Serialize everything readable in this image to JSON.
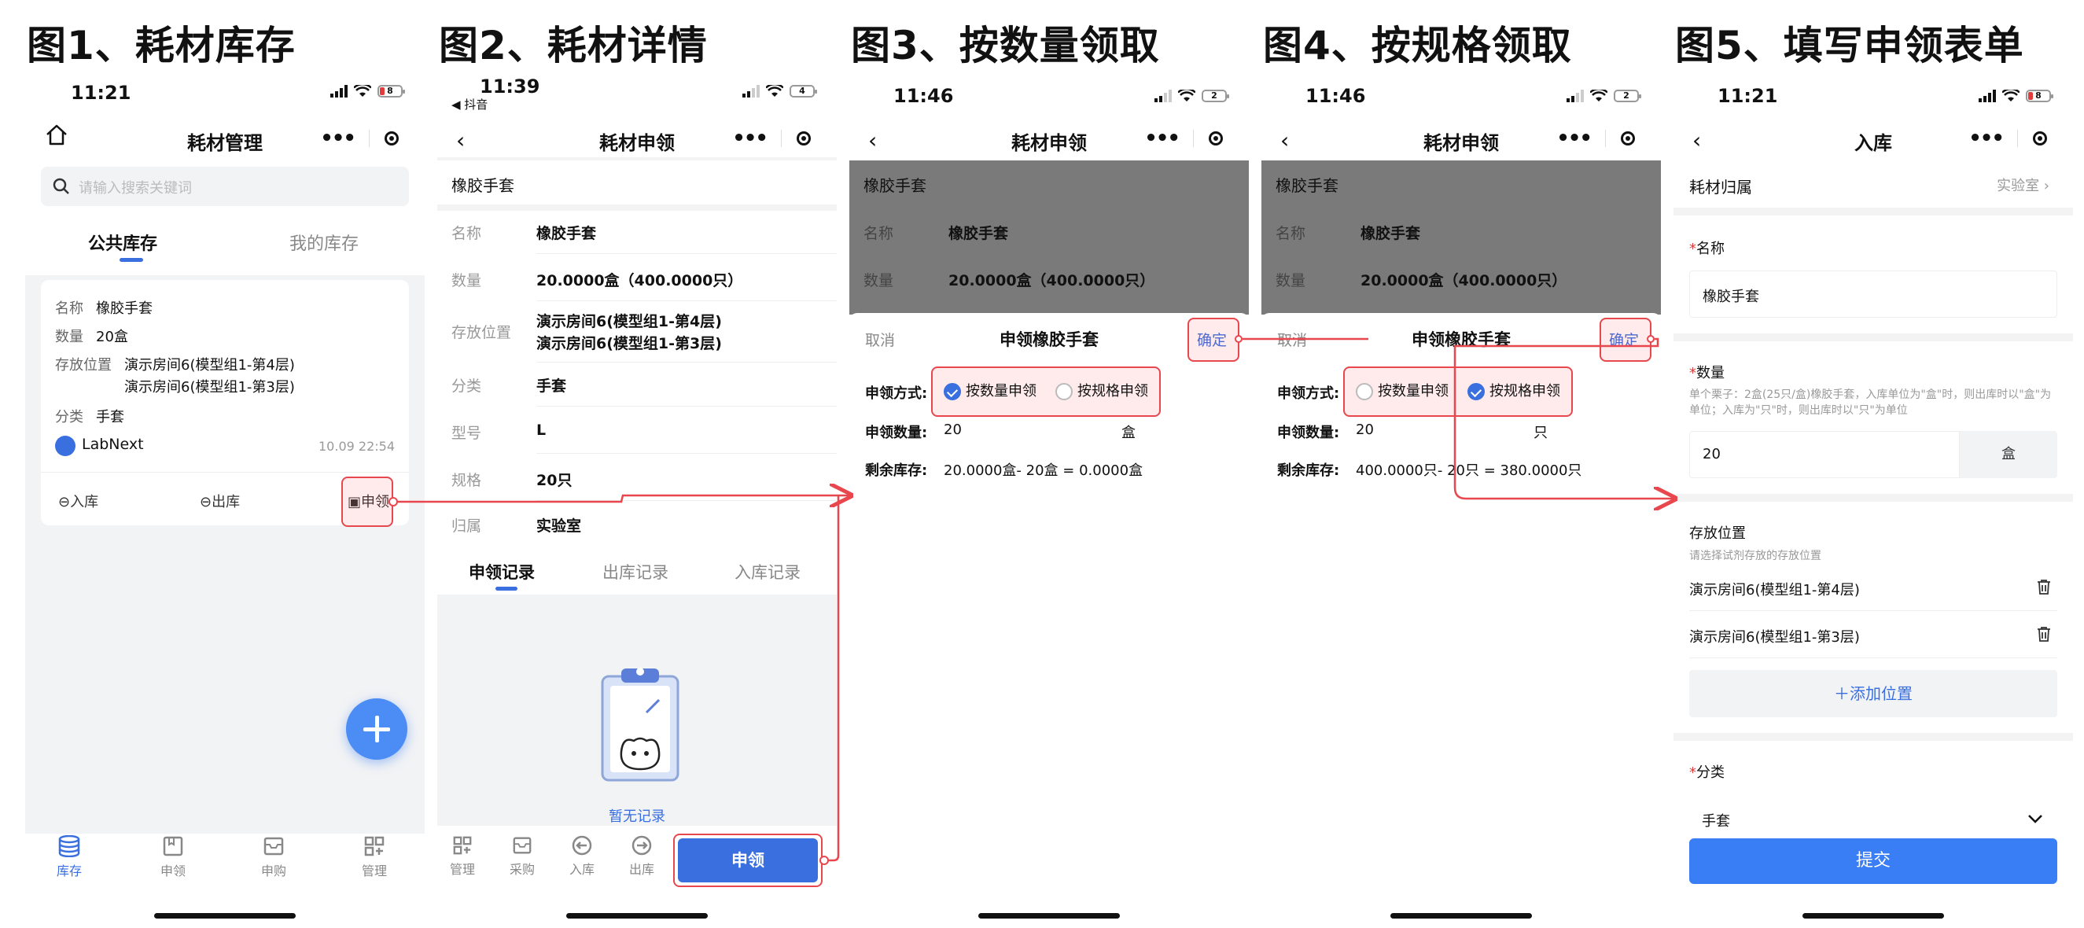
{
  "figures": [
    {
      "title": "图1、耗材库存",
      "time": "11:21",
      "battery": "8",
      "nav_title": "耗材管理"
    },
    {
      "title": "图2、耗材详情",
      "time": "11:39",
      "sub_time": "◀ 抖音",
      "battery": "4",
      "nav_title": "耗材申领"
    },
    {
      "title": "图3、按数量领取",
      "time": "11:46",
      "battery": "2",
      "nav_title": "耗材申领"
    },
    {
      "title": "图4、按规格领取",
      "time": "11:46",
      "battery": "2",
      "nav_title": "耗材申领"
    },
    {
      "title": "图5、填写申领表单",
      "time": "11:21",
      "battery": "8",
      "nav_title": "入库"
    }
  ],
  "fig1": {
    "search_placeholder": "请输入搜索关键词",
    "tabs": [
      "公共库存",
      "我的库存"
    ],
    "card": {
      "name_label": "名称",
      "name": "橡胶手套",
      "qty_label": "数量",
      "qty": "20盒",
      "loc_label": "存放位置",
      "loc1": "演示房间6(模型组1-第4层)",
      "loc2": "演示房间6(模型组1-第3层)",
      "cat_label": "分类",
      "cat": "手套",
      "owner": "LabNext",
      "date": "10.09 22:54",
      "btn_in": "入库",
      "btn_out": "出库",
      "btn_apply": "申领"
    },
    "tabbar": [
      "库存",
      "申领",
      "申购",
      "管理"
    ]
  },
  "fig2": {
    "header": "橡胶手套",
    "rows": [
      {
        "label": "名称",
        "value": "橡胶手套"
      },
      {
        "label": "数量",
        "value": "20.0000盒（400.0000只）"
      },
      {
        "label": "存放位置",
        "value": "演示房间6(模型组1-第4层)",
        "value2": "演示房间6(模型组1-第3层)"
      },
      {
        "label": "分类",
        "value": "手套"
      },
      {
        "label": "型号",
        "value": "L"
      },
      {
        "label": "规格",
        "value": "20只"
      },
      {
        "label": "归属",
        "value": "实验室"
      }
    ],
    "tabs": [
      "申领记录",
      "出库记录",
      "入库记录"
    ],
    "empty_text": "暂无记录",
    "tabbar": [
      "管理",
      "采购",
      "入库",
      "出库"
    ],
    "apply_button": "申领"
  },
  "fig3": {
    "header": "橡胶手套",
    "bg_name_label": "名称",
    "bg_name": "橡胶手套",
    "bg_qty_label": "数量",
    "bg_qty": "20.0000盒（400.0000只）",
    "cancel": "取消",
    "sheet_title": "申领橡胶手套",
    "confirm": "确定",
    "method_label": "申领方式:",
    "opt_qty": "按数量申领",
    "opt_spec": "按规格申领",
    "amount_label": "申领数量:",
    "amount": "20",
    "unit": "盒",
    "remain_label": "剩余库存:",
    "remain": "20.0000盒- 20盒 = 0.0000盒"
  },
  "fig4": {
    "header": "橡胶手套",
    "bg_name_label": "名称",
    "bg_name": "橡胶手套",
    "bg_qty_label": "数量",
    "bg_qty": "20.0000盒（400.0000只）",
    "cancel": "取消",
    "sheet_title": "申领橡胶手套",
    "confirm": "确定",
    "method_label": "申领方式:",
    "opt_qty": "按数量申领",
    "opt_spec": "按规格申领",
    "amount_label": "申领数量:",
    "amount": "20",
    "unit": "只",
    "remain_label": "剩余库存:",
    "remain": "400.0000只- 20只 = 380.0000只"
  },
  "fig5": {
    "owner_label": "耗材归属",
    "owner_value": "实验室",
    "name_label": "名称",
    "name_value": "橡胶手套",
    "qty_label": "数量",
    "qty_hint": "单个栗子：2盒(25只/盒)橡胶手套，入库单位为\"盒\"时，则出库时以\"盒\"为单位；入库为\"只\"时，则出库时以\"只\"为单位",
    "qty_value": "20",
    "qty_unit": "盒",
    "loc_label": "存放位置",
    "loc_hint": "请选择试剂存放的存放位置",
    "loc1": "演示房间6(模型组1-第4层)",
    "loc2": "演示房间6(模型组1-第3层)",
    "add_loc": "＋添加位置",
    "cat_label": "分类",
    "cat_value": "手套",
    "submit": "提交",
    "star": "*"
  },
  "colors": {
    "accent": "#3a6fe0",
    "highlight": "#e8474e",
    "fab": "#4b8cf5",
    "overlay": "#7a7a7a"
  }
}
